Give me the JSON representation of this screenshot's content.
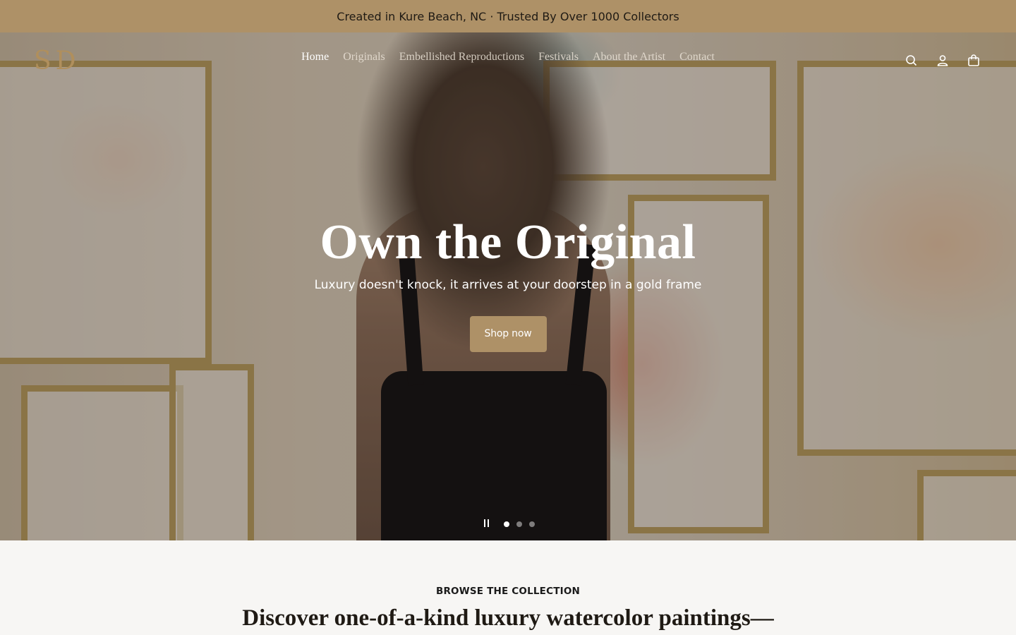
{
  "announcement": {
    "text": "Created in Kure Beach, NC · Trusted By Over 1000 Collectors"
  },
  "header": {
    "logo": "SD",
    "nav": [
      {
        "label": "Home",
        "active": true
      },
      {
        "label": "Originals",
        "active": false
      },
      {
        "label": "Embellished Reproductions",
        "active": false
      },
      {
        "label": "Festivals",
        "active": false
      },
      {
        "label": "About the Artist",
        "active": false
      },
      {
        "label": "Contact",
        "active": false
      }
    ],
    "icons": [
      "search-icon",
      "account-icon",
      "cart-icon"
    ]
  },
  "hero": {
    "title": "Own the Original",
    "subtitle": "Luxury doesn't knock, it arrives at your doorstep in a gold frame",
    "button_label": "Shop now",
    "slides": 3,
    "active_slide": 1
  },
  "collection": {
    "eyebrow": "BROWSE THE COLLECTION",
    "heading": "Discover one-of-a-kind luxury watercolor paintings—"
  },
  "colors": {
    "accent": "#ae9167",
    "logo": "#b08f5c",
    "page_bg": "#f7f6f4"
  }
}
